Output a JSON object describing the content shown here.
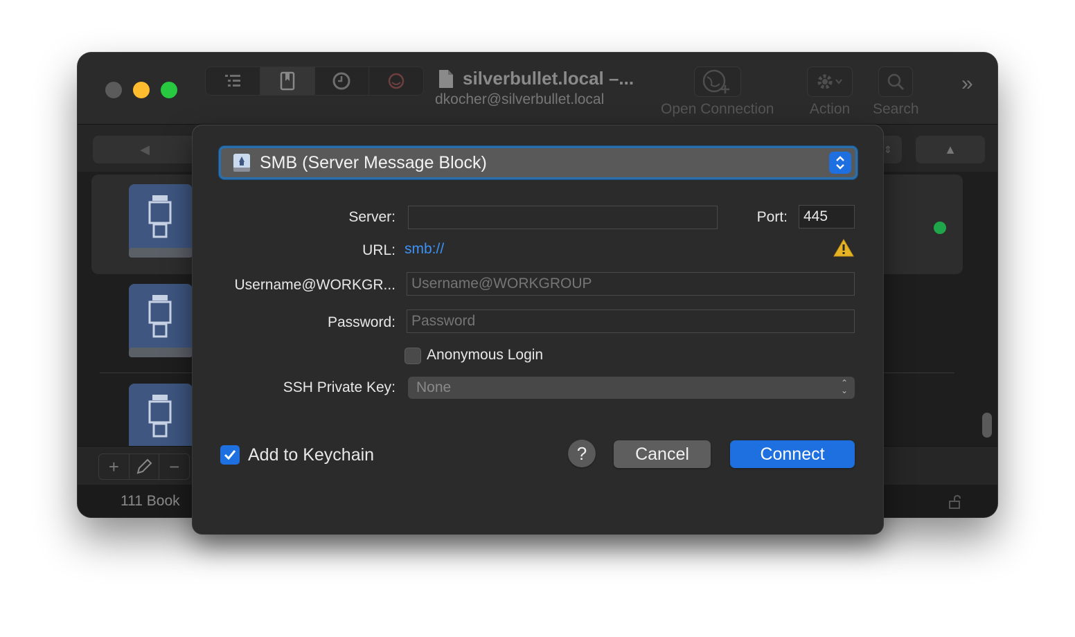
{
  "window": {
    "title": "silverbullet.local –...",
    "subtitle": "dkocher@silverbullet.local",
    "toolbar": {
      "open_connection_label": "Open Connection",
      "action_label": "Action",
      "search_label": "Search"
    },
    "footer_text": "111 Book",
    "status_color": "#1fa64a"
  },
  "dialog": {
    "protocol": "SMB (Server Message Block)",
    "server_label": "Server:",
    "server_value": "",
    "port_label": "Port:",
    "port_value": "445",
    "url_label": "URL:",
    "url_value": "smb://",
    "username_label": "Username@WORKGR...",
    "username_placeholder": "Username@WORKGROUP",
    "password_label": "Password:",
    "password_placeholder": "Password",
    "anonymous_label": "Anonymous Login",
    "anonymous_checked": false,
    "ssh_key_label": "SSH Private Key:",
    "ssh_key_value": "None",
    "keychain_label": "Add to Keychain",
    "keychain_checked": true,
    "help_label": "?",
    "cancel_label": "Cancel",
    "connect_label": "Connect",
    "accent_color": "#1e6fe0",
    "link_color": "#3d92f5",
    "warning_color": "#e6b422"
  }
}
